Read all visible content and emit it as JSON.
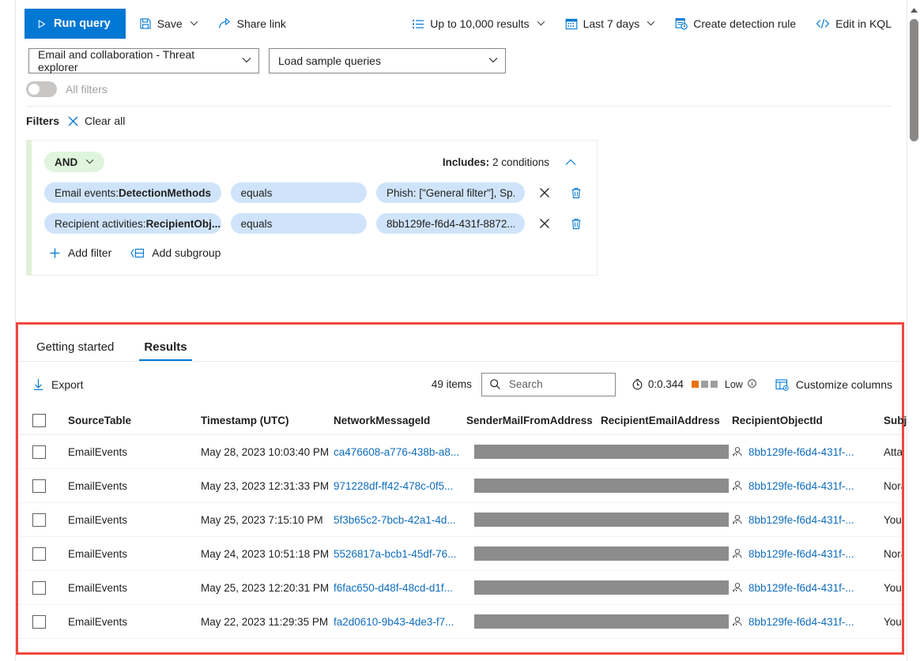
{
  "toolbar": {
    "run_query": "Run query",
    "save": "Save",
    "share_link": "Share link",
    "results_limit": "Up to 10,000 results",
    "time_range": "Last 7 days",
    "create_detection_rule": "Create detection rule",
    "edit_in_kql": "Edit in KQL"
  },
  "query_row": {
    "source_combo": "Email and collaboration - Threat explorer",
    "sample_queries_combo": "Load sample queries"
  },
  "all_filters_toggle": {
    "label": "All filters",
    "state": "off"
  },
  "filters": {
    "title": "Filters",
    "clear_all": "Clear all",
    "group": {
      "operator": "AND",
      "includes_label": "Includes:",
      "includes_value": "2 conditions",
      "conditions": [
        {
          "field": "Email events: DetectionMethods",
          "field_prefix": "Email events: ",
          "field_name": "DetectionMethods",
          "operator": "equals",
          "value": "Phish: [\"General filter\"], Sp..."
        },
        {
          "field": "Recipient activities: RecipientObj...",
          "field_prefix": "Recipient activities: ",
          "field_name": "RecipientObj...",
          "operator": "equals",
          "value": "8bb129fe-f6d4-431f-8872..."
        }
      ],
      "add_filter": "Add filter",
      "add_subgroup": "Add subgroup"
    }
  },
  "results_panel": {
    "highlight_color": "#f0483e",
    "tabs": [
      {
        "label": "Getting started",
        "active": false
      },
      {
        "label": "Results",
        "active": true
      }
    ],
    "command_bar": {
      "export": "Export",
      "items_count": "49 items",
      "search_placeholder": "Search",
      "search_value": "",
      "elapsed": "0:0.344",
      "complexity": "Low",
      "complexity_filled_bars": 1,
      "complexity_total_bars": 3,
      "complexity_color": "#e8730a",
      "complexity_empty_color": "#a19f9d",
      "customize_columns": "Customize columns"
    },
    "table": {
      "columns": [
        "SourceTable",
        "Timestamp (UTC)",
        "NetworkMessageId",
        "SenderMailFromAddress",
        "RecipientEmailAddress",
        "RecipientObjectId",
        "Subject"
      ],
      "rows": [
        {
          "source_table": "EmailEvents",
          "timestamp": "May 28, 2023 10:03:40 PM",
          "network_message_id": "ca476608-a776-438b-a8...",
          "sender_mail_from_address": "[redacted]",
          "sender_trailing": "..",
          "recipient_email_address": "[redacted]",
          "recipient_object_id": "8bb129fe-f6d4-431f-...",
          "subject": "Attach"
        },
        {
          "source_table": "EmailEvents",
          "timestamp": "May 23, 2023 12:31:33 PM",
          "network_message_id": "971228df-ff42-478c-0f5...",
          "sender_mail_from_address": "[redacted]",
          "sender_trailing": "..",
          "recipient_email_address": "[redacted]",
          "recipient_object_id": "8bb129fe-f6d4-431f-...",
          "subject": "Norah"
        },
        {
          "source_table": "EmailEvents",
          "timestamp": "May 25, 2023 7:15:10 PM",
          "network_message_id": "5f3b65c2-7bcb-42a1-4d...",
          "sender_mail_from_address": "[redacted]",
          "sender_trailing": "..",
          "recipient_email_address": "[redacted]",
          "recipient_object_id": "8bb129fe-f6d4-431f-...",
          "subject": "You ha"
        },
        {
          "source_table": "EmailEvents",
          "timestamp": "May 24, 2023 10:51:18 PM",
          "network_message_id": "5526817a-bcb1-45df-76...",
          "sender_mail_from_address": "[redacted]",
          "sender_trailing": "..",
          "recipient_email_address": "[redacted]",
          "recipient_object_id": "8bb129fe-f6d4-431f-...",
          "subject": "Norah"
        },
        {
          "source_table": "EmailEvents",
          "timestamp": "May 25, 2023 12:20:31 PM",
          "network_message_id": "f6fac650-d48f-48cd-d1f...",
          "sender_mail_from_address": "[redacted]",
          "sender_trailing": "..",
          "recipient_email_address": "[redacted]",
          "recipient_object_id": "8bb129fe-f6d4-431f-...",
          "subject": "You ha"
        },
        {
          "source_table": "EmailEvents",
          "timestamp": "May 22, 2023 11:29:35 PM",
          "network_message_id": "fa2d0610-9b43-4de3-f7...",
          "sender_mail_from_address": "[redacted]",
          "sender_trailing": "..",
          "recipient_email_address": "[redacted]",
          "recipient_object_id": "8bb129fe-f6d4-431f-...",
          "subject": "You ha"
        }
      ]
    }
  },
  "colors": {
    "accent": "#0078d4",
    "link": "#0f6cbd",
    "pill_blue": "#cfe4fa",
    "pill_green": "#dff6dd",
    "highlight_red": "#f0483e"
  }
}
